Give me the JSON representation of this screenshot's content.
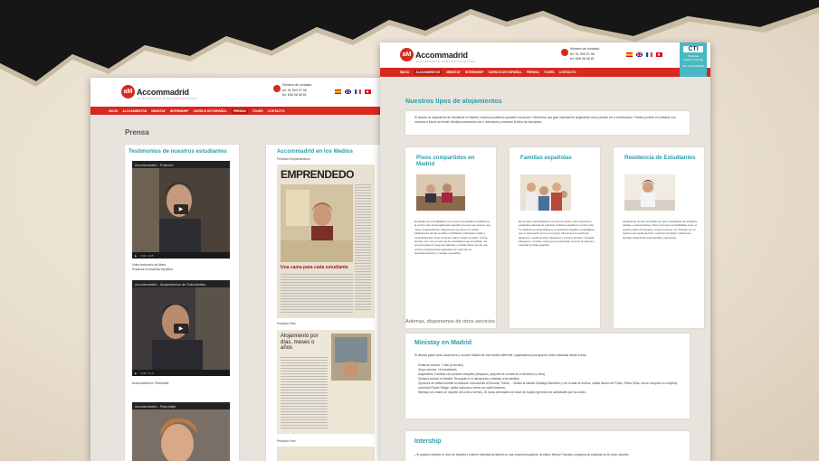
{
  "site": {
    "logo_badge": "aM",
    "logo_text": "Accommadrid",
    "logo_sub": "ALOJAMIENTO PARA ESTUDIANTES",
    "contact_label": "Número de contacto",
    "phone1": "tel. 91 593 07 98",
    "phone2": "tel. 608 08 08 81",
    "brand_red": "#d8291f",
    "teal": "#2a9ca8"
  },
  "nav1": [
    "INICIO",
    "ALOJAMIENTOS",
    "MINISTAY",
    "INTERNSHIP",
    "CURSOS DE ESPAÑOL",
    "PRENSA",
    "TOURS",
    "CONTACTO"
  ],
  "nav2": [
    "INICIO",
    "ALOJAMIENTOS",
    "MINISTAY",
    "INTERNSHIP",
    "CURSOS DE ESPAÑOL",
    "PRENSA",
    "TOURS",
    "CONTACTO"
  ],
  "page1": {
    "heading": "Prensa",
    "testimonials_title": "Testimonios de nuestros estudiantes",
    "media_title": "Accommadrid en los Medios",
    "videos": [
      {
        "title": "Accommadrid - Francés",
        "time": "0:00 / 2:25",
        "caption1": "Video-testimonio de Albert.",
        "caption2": "Prácticas en empresa española"
      },
      {
        "title": "Accommadrid - Alojamientos de Estudiantes",
        "time": "0:00 / 2:13",
        "caption1": "Accommadrid en Telemadrid.",
        "caption2": ""
      },
      {
        "title": "Accommadrid - Reportaje",
        "time": "",
        "caption1": "",
        "caption2": ""
      }
    ],
    "press": [
      {
        "source": "Periódico Emprendedores",
        "headline": "EMPRENDEDO",
        "sub": "Una cama para cada estudiante"
      },
      {
        "source": "Periódico País",
        "headline": "Alojamiento por días, meses o años",
        "sub": ""
      },
      {
        "source": "Periódico Faro",
        "headline": "",
        "sub": ""
      }
    ]
  },
  "page2": {
    "heading": "Nuestros tipos de alojamientos",
    "intro": "Si buscas un alojamiento de estudiante en Madrid, nosotros podremos ayudarte a buscarlo. Ofrecemos una gran variedad de alojamiento como puedes ver a continuación. Puedes ponerte en contacto con nosotros a través del email: info@accommadrid.com o rellenando y enviando la ficha de inscripción.",
    "types": [
      {
        "title": "Pisos compartidos en Madrid",
        "text": "El alquiler de una habitación en un piso compartido en Madrid es la opción más aconsejada para aquellos jóvenes que deseen una mayor independencia. Disponemos de pisos con varias habitaciones donde tendrás tu habitación individual o doble y compartirás las zonas comunes (salón, cuarto de baño, cocina, terraza, etc.) con el resto de los estudiantes que la habiten. Se proporcionará un juego de sábanas y podrás hacer uso de una cocina completamente equipada con todo tipo de electrodomésticos y menaje necesarios."
      },
      {
        "title": "Familias españolas",
        "text": "Es la mejor oportunidad de conocer la cultura y las costumbres españolas además de practicar el idioma español en el día a día. Tu estancia se desarrollará en un ambiente familiar y hospitalario que te hará sentir como en tu hogar. Ofrecemos la opción de desayuno, media pensión (desayuno y cena) o pensión completa (desayuno, comida y cena) que te permitirán conocer la riqueza y variedad comida española."
      },
      {
        "title": "Residencia de Estudiantes",
        "text": "Alojamiento donde convivirás con otros estudiantes de similares edades y características. Tiene una serie de facilidades como el servicio diario de limpieza, zonas comunes, etc. Pueden ser en régimen de media pensión o pensión completa. Ofrecemos también alojamiento para familias y ejecutivos."
      }
    ],
    "other_heading": "Ademas, disponemos de otros servicios",
    "ministay_title": "Ministay en Madrid",
    "ministay_intro": "Si deseas pasar unas vacaciones y conocer Madrid de una manera diferente, organizamos para grupos cortas estancias desde 6 días.",
    "ministay_items": [
      "Estancia mínima: 7 días (6 noches)",
      "Grupo mínimo: 15 estudiantes",
      "Alojamiento: Familias con pensión completa (desayuno, paquete de comida en el almuerzo y cena).",
      "Semana cultural en Madrid. Recogida en el aeropuerto y traslado a las familias.",
      "Opciones de visitas durante la estancia: excursiones al Escorial, Toledo, ...Visitas al estadio Santiago Bernabéu y ver la sala de trofeos, visitas Museo del Prado, Reina Sofía, día de compras en complejo comercial Rozas Village, salida nocturna a cenar con baile flamenco.",
      "Ministay con clases de español de lunes a viernes, 15 horas semanales de clase de español general con actividades por las tardes."
    ],
    "intership_title": "Intership",
    "intership_text": "¿Te gustaría mejorar tu nivel de español y obtener experiencia laboral en una empresa española, al mismo tiempo? Nuestro programa de prácticas es la mejor solución"
  },
  "cti": {
    "logo": "CTI",
    "line1": "Prácticas",
    "line2": "Cultural Training",
    "line3": "Info Accommadrid"
  }
}
